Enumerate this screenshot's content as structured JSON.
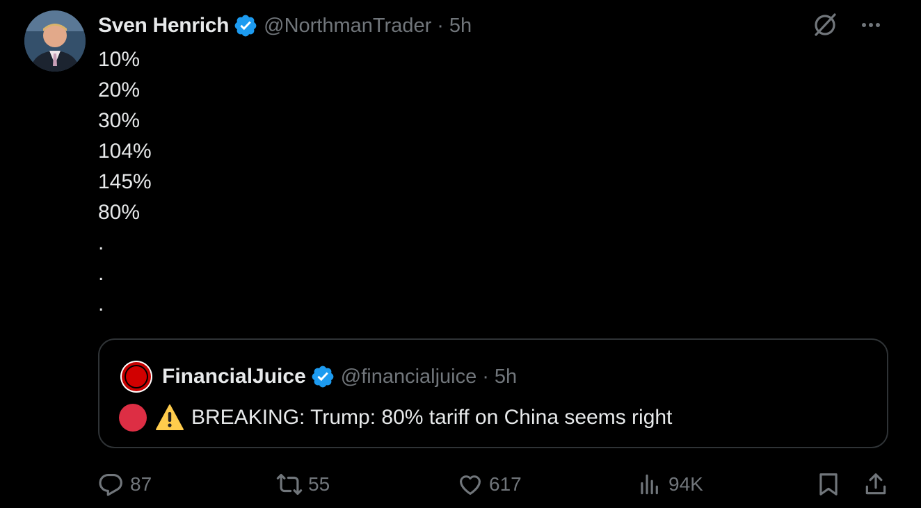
{
  "tweet": {
    "author": {
      "display_name": "Sven Henrich",
      "handle": "@NorthmanTrader",
      "separator": "·",
      "time": "5h",
      "verified": true
    },
    "body_lines": [
      "10%",
      "20%",
      "30%",
      "104%",
      "145%",
      "80%",
      ".",
      ".",
      "."
    ],
    "top_icons": [
      "grok-icon",
      "more-icon"
    ],
    "quote": {
      "display_name": "FinancialJuice",
      "handle": "@financialjuice",
      "separator": "·",
      "time": "5h",
      "verified": true,
      "text": "BREAKING: Trump: 80% tariff on China seems right",
      "emoji": [
        "red-circle-icon",
        "warning-icon"
      ]
    },
    "actions": {
      "replies": "87",
      "reposts": "55",
      "likes": "617",
      "views": "94K"
    }
  },
  "colors": {
    "background": "#000000",
    "text_primary": "#e7e9ea",
    "text_secondary": "#71767b",
    "verified_blue": "#1d9bf0",
    "border": "#2f3336",
    "red_circle": "#dd2e44",
    "brand_red": "#c60000"
  }
}
